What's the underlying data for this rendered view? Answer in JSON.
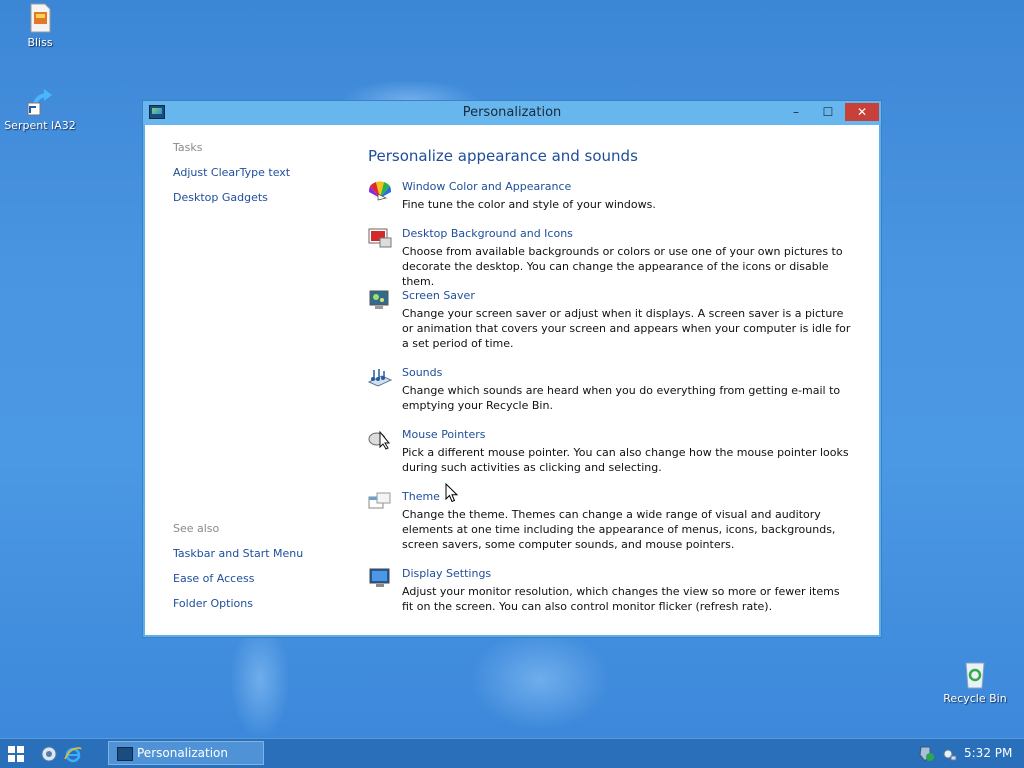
{
  "desktop": {
    "icons": [
      {
        "label": "Bliss",
        "icon": "image-file-icon"
      },
      {
        "label": "Serpent IA32",
        "icon": "shortcut-icon"
      },
      {
        "label": "Recycle Bin",
        "icon": "recycle-bin-icon"
      }
    ]
  },
  "window": {
    "title": "Personalization",
    "controls": {
      "minimize": "–",
      "maximize": "☐",
      "close": "✕"
    },
    "left_pane": {
      "tasks_heading": "Tasks",
      "tasks": [
        "Adjust ClearType text",
        "Desktop Gadgets"
      ],
      "see_also_heading": "See also",
      "see_also": [
        "Taskbar and Start Menu",
        "Ease of Access",
        "Folder Options"
      ]
    },
    "main": {
      "title": "Personalize appearance and sounds",
      "items": [
        {
          "link": "Window Color and Appearance",
          "desc": "Fine tune the color and style of your windows.",
          "icon": "color-wheel-icon"
        },
        {
          "link": "Desktop Background and Icons",
          "desc": "Choose from available backgrounds or colors or use one of your own pictures to decorate the desktop. You can change the appearance of the icons or disable them.",
          "icon": "desktop-background-icon"
        },
        {
          "link": "Screen Saver",
          "desc": "Change your screen saver or adjust when it displays. A screen saver is a picture or animation that covers your screen and appears when your computer is idle for a set period of time.",
          "icon": "screen-saver-icon"
        },
        {
          "link": "Sounds",
          "desc": "Change which sounds are heard when you do everything from getting e-mail to emptying your Recycle Bin.",
          "icon": "sounds-icon"
        },
        {
          "link": "Mouse Pointers",
          "desc": "Pick a different mouse pointer. You can also change how the mouse pointer looks during such activities as clicking and selecting.",
          "icon": "mouse-pointer-icon"
        },
        {
          "link": "Theme",
          "desc": "Change the theme. Themes can change a wide range of visual and auditory elements at one time including the appearance of menus, icons, backgrounds, screen savers, some computer sounds, and mouse pointers.",
          "icon": "theme-icon"
        },
        {
          "link": "Display Settings",
          "desc": "Adjust your monitor resolution, which changes the view so more or fewer items fit on the screen. You can also control monitor flicker (refresh rate).",
          "icon": "monitor-icon"
        }
      ]
    }
  },
  "taskbar": {
    "task_label": "Personalization",
    "clock": "5:32 PM"
  },
  "colors": {
    "desktop": "#4a95e1",
    "titlebar": "#68b6ee",
    "link": "#1e4e9a",
    "close_button": "#c7403a",
    "taskbar": "#2a6fba"
  }
}
